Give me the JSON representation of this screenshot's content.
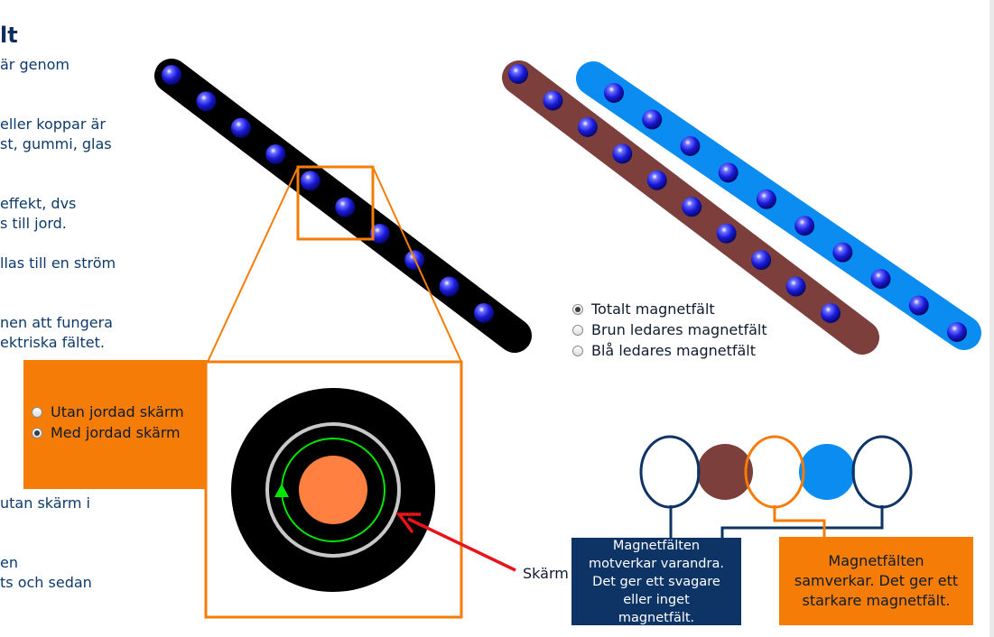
{
  "title": "lt",
  "paragraphs": [
    "är genom",
    "eller koppar är\nst, gummi, glas",
    "effekt, dvs\ns till jord.",
    "llas till en ström",
    "nen att fungera\nektriska fältet.",
    "utan skärm i",
    "en\nts och sedan"
  ],
  "shield_options": [
    {
      "label": "Utan jordad skärm",
      "checked": false
    },
    {
      "label": "Med jordad skärm",
      "checked": true
    }
  ],
  "field_options": [
    {
      "label": "Totalt magnetfält",
      "checked": true
    },
    {
      "label": "Brun ledares magnetfält",
      "checked": false
    },
    {
      "label": "Blå ledares magnetfält",
      "checked": false
    }
  ],
  "screen_label": "Skärm",
  "info": {
    "oppose": "Magnetfälten motverkar varandra. Det ger ett svagare eller inget magnetfält.",
    "cooperate": "Magnetfälten samverkar. Det ger ett starkare magnetfält."
  },
  "colors": {
    "navy": "#0d3465",
    "orange": "#f57d07",
    "brown": "#7d3f3c",
    "blue": "#0a8cf0",
    "electron": "#1a1ad9",
    "core": "#ff8040",
    "field_green": "#00e600",
    "arrow_red": "#e8141a"
  }
}
